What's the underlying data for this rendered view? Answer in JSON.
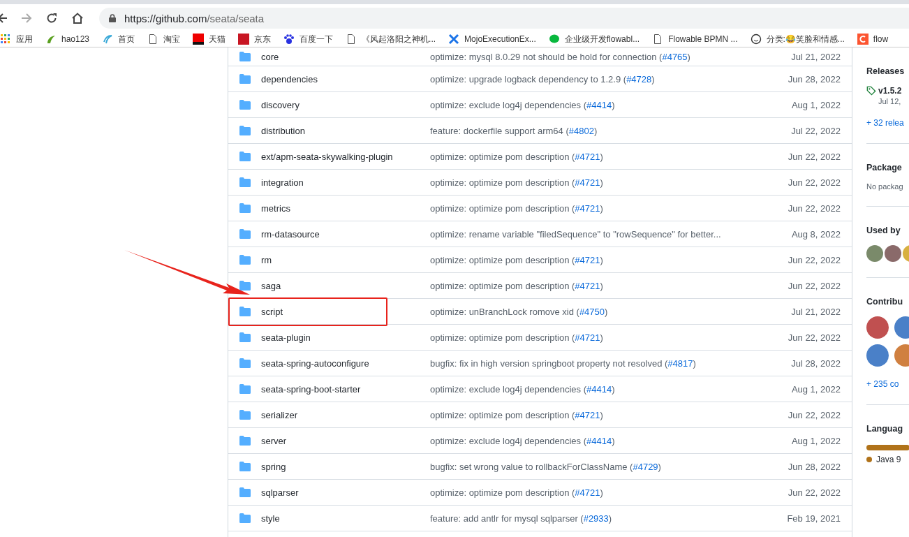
{
  "browser": {
    "url_host": "https://github.com",
    "url_path": "/seata/seata",
    "bookmarks": [
      {
        "label": "应用"
      },
      {
        "label": "hao123"
      },
      {
        "label": "首页"
      },
      {
        "label": "淘宝"
      },
      {
        "label": "天猫"
      },
      {
        "label": "京东"
      },
      {
        "label": "百度一下"
      },
      {
        "label": "《风起洛阳之神机..."
      },
      {
        "label": "MojoExecutionEx..."
      },
      {
        "label": "企业级开发flowabl..."
      },
      {
        "label": "Flowable BPMN ..."
      },
      {
        "label": "分类:😂笑脸和情感..."
      },
      {
        "label": "flow"
      }
    ]
  },
  "files": [
    {
      "name": "core",
      "message": "optimize: mysql 8.0.29 not should be hold for connection (",
      "issue": "#4765",
      "close": ")",
      "date": "Jul 21, 2022",
      "highlighted": false
    },
    {
      "name": "dependencies",
      "message": "optimize: upgrade logback dependency to 1.2.9 (",
      "issue": "#4728",
      "close": ")",
      "date": "Jun 28, 2022",
      "highlighted": false
    },
    {
      "name": "discovery",
      "message": "optimize: exclude log4j dependencies (",
      "issue": "#4414",
      "close": ")",
      "date": "Aug 1, 2022",
      "highlighted": false
    },
    {
      "name": "distribution",
      "message": "feature: dockerfile support arm64 (",
      "issue": "#4802",
      "close": ")",
      "date": "Jul 22, 2022",
      "highlighted": false
    },
    {
      "name": "ext/apm-seata-skywalking-plugin",
      "message": "optimize: optimize pom description (",
      "issue": "#4721",
      "close": ")",
      "date": "Jun 22, 2022",
      "highlighted": false
    },
    {
      "name": "integration",
      "message": "optimize: optimize pom description (",
      "issue": "#4721",
      "close": ")",
      "date": "Jun 22, 2022",
      "highlighted": false
    },
    {
      "name": "metrics",
      "message": "optimize: optimize pom description (",
      "issue": "#4721",
      "close": ")",
      "date": "Jun 22, 2022",
      "highlighted": false
    },
    {
      "name": "rm-datasource",
      "message": "optimize: rename variable \"filedSequence\" to \"rowSequence\" for better...",
      "date": "Aug 8, 2022",
      "highlighted": false
    },
    {
      "name": "rm",
      "message": "optimize: optimize pom description (",
      "issue": "#4721",
      "close": ")",
      "date": "Jun 22, 2022",
      "highlighted": false
    },
    {
      "name": "saga",
      "message": "optimize: optimize pom description (",
      "issue": "#4721",
      "close": ")",
      "date": "Jun 22, 2022",
      "highlighted": false
    },
    {
      "name": "script",
      "message": "optimize: unBranchLock romove xid (",
      "issue": "#4750",
      "close": ")",
      "date": "Jul 21, 2022",
      "highlighted": true
    },
    {
      "name": "seata-plugin",
      "message": "optimize: optimize pom description (",
      "issue": "#4721",
      "close": ")",
      "date": "Jun 22, 2022",
      "highlighted": false
    },
    {
      "name": "seata-spring-autoconfigure",
      "message": "bugfix: fix in high version springboot property not resolved (",
      "issue": "#4817",
      "close": ")",
      "date": "Jul 28, 2022",
      "highlighted": false
    },
    {
      "name": "seata-spring-boot-starter",
      "message": "optimize: exclude log4j dependencies (",
      "issue": "#4414",
      "close": ")",
      "date": "Aug 1, 2022",
      "highlighted": false
    },
    {
      "name": "serializer",
      "message": "optimize: optimize pom description (",
      "issue": "#4721",
      "close": ")",
      "date": "Jun 22, 2022",
      "highlighted": false
    },
    {
      "name": "server",
      "message": "optimize: exclude log4j dependencies (",
      "issue": "#4414",
      "close": ")",
      "date": "Aug 1, 2022",
      "highlighted": false
    },
    {
      "name": "spring",
      "message": "bugfix: set wrong value to rollbackForClassName (",
      "issue": "#4729",
      "close": ")",
      "date": "Jun 28, 2022",
      "highlighted": false
    },
    {
      "name": "sqlparser",
      "message": "optimize: optimize pom description (",
      "issue": "#4721",
      "close": ")",
      "date": "Jun 22, 2022",
      "highlighted": false
    },
    {
      "name": "style",
      "message": "feature: add antlr for mysql sqlparser (",
      "issue": "#2933",
      "close": ")",
      "date": "Feb 19, 2021",
      "highlighted": false
    }
  ],
  "sidebar": {
    "releases": {
      "title": "Releases",
      "tag": "v1.5.2",
      "date": "Jul 12,",
      "more": "+ 32 relea"
    },
    "packages": {
      "title": "Package",
      "text": "No packag"
    },
    "used_by": {
      "title": "Used by"
    },
    "contributors": {
      "title": "Contribu",
      "more": "+ 235 co"
    },
    "languages": {
      "title": "Languag",
      "items": [
        {
          "label": "Java 9",
          "color": "#b07219"
        }
      ]
    }
  }
}
